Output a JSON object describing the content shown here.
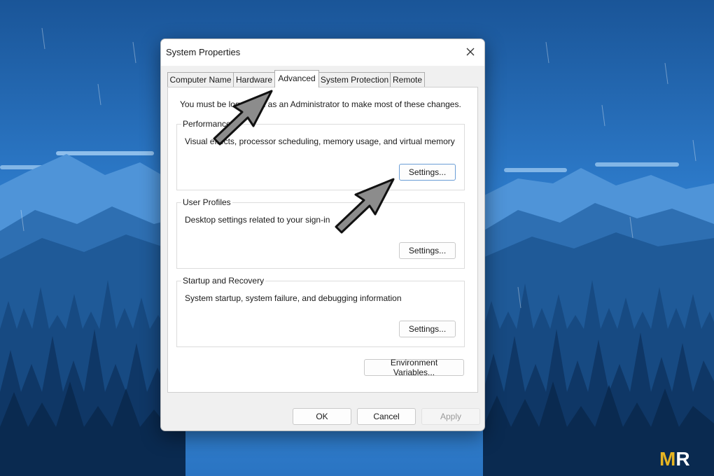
{
  "dialog": {
    "title": "System Properties",
    "close_label": "Close"
  },
  "tabs": [
    {
      "label": "Computer Name",
      "active": false
    },
    {
      "label": "Hardware",
      "active": false
    },
    {
      "label": "Advanced",
      "active": true
    },
    {
      "label": "System Protection",
      "active": false
    },
    {
      "label": "Remote",
      "active": false
    }
  ],
  "advanced": {
    "note": "You must be logged on as an Administrator to make most of these changes.",
    "groups": [
      {
        "title": "Performance",
        "description": "Visual effects, processor scheduling, memory usage, and virtual memory",
        "button": "Settings..."
      },
      {
        "title": "User Profiles",
        "description": "Desktop settings related to your sign-in",
        "button": "Settings..."
      },
      {
        "title": "Startup and Recovery",
        "description": "System startup, system failure, and debugging information",
        "button": "Settings..."
      }
    ],
    "env_button": "Environment Variables..."
  },
  "footer": {
    "ok": "OK",
    "cancel": "Cancel",
    "apply": "Apply"
  },
  "watermark": {
    "m": "M",
    "r": "R"
  },
  "colors": {
    "sky_top": "#1c5a9e",
    "sky_bottom": "#3b8ee0",
    "mountain_far": "#3d7ec4",
    "forest_dark": "#0b2b55",
    "watermark_m": "#e6b422",
    "watermark_r": "#ffffff",
    "annotation_arrow": "#8c8c8c"
  },
  "icons": {
    "close": "close-icon",
    "annotation": "annotation-arrow-icon"
  }
}
